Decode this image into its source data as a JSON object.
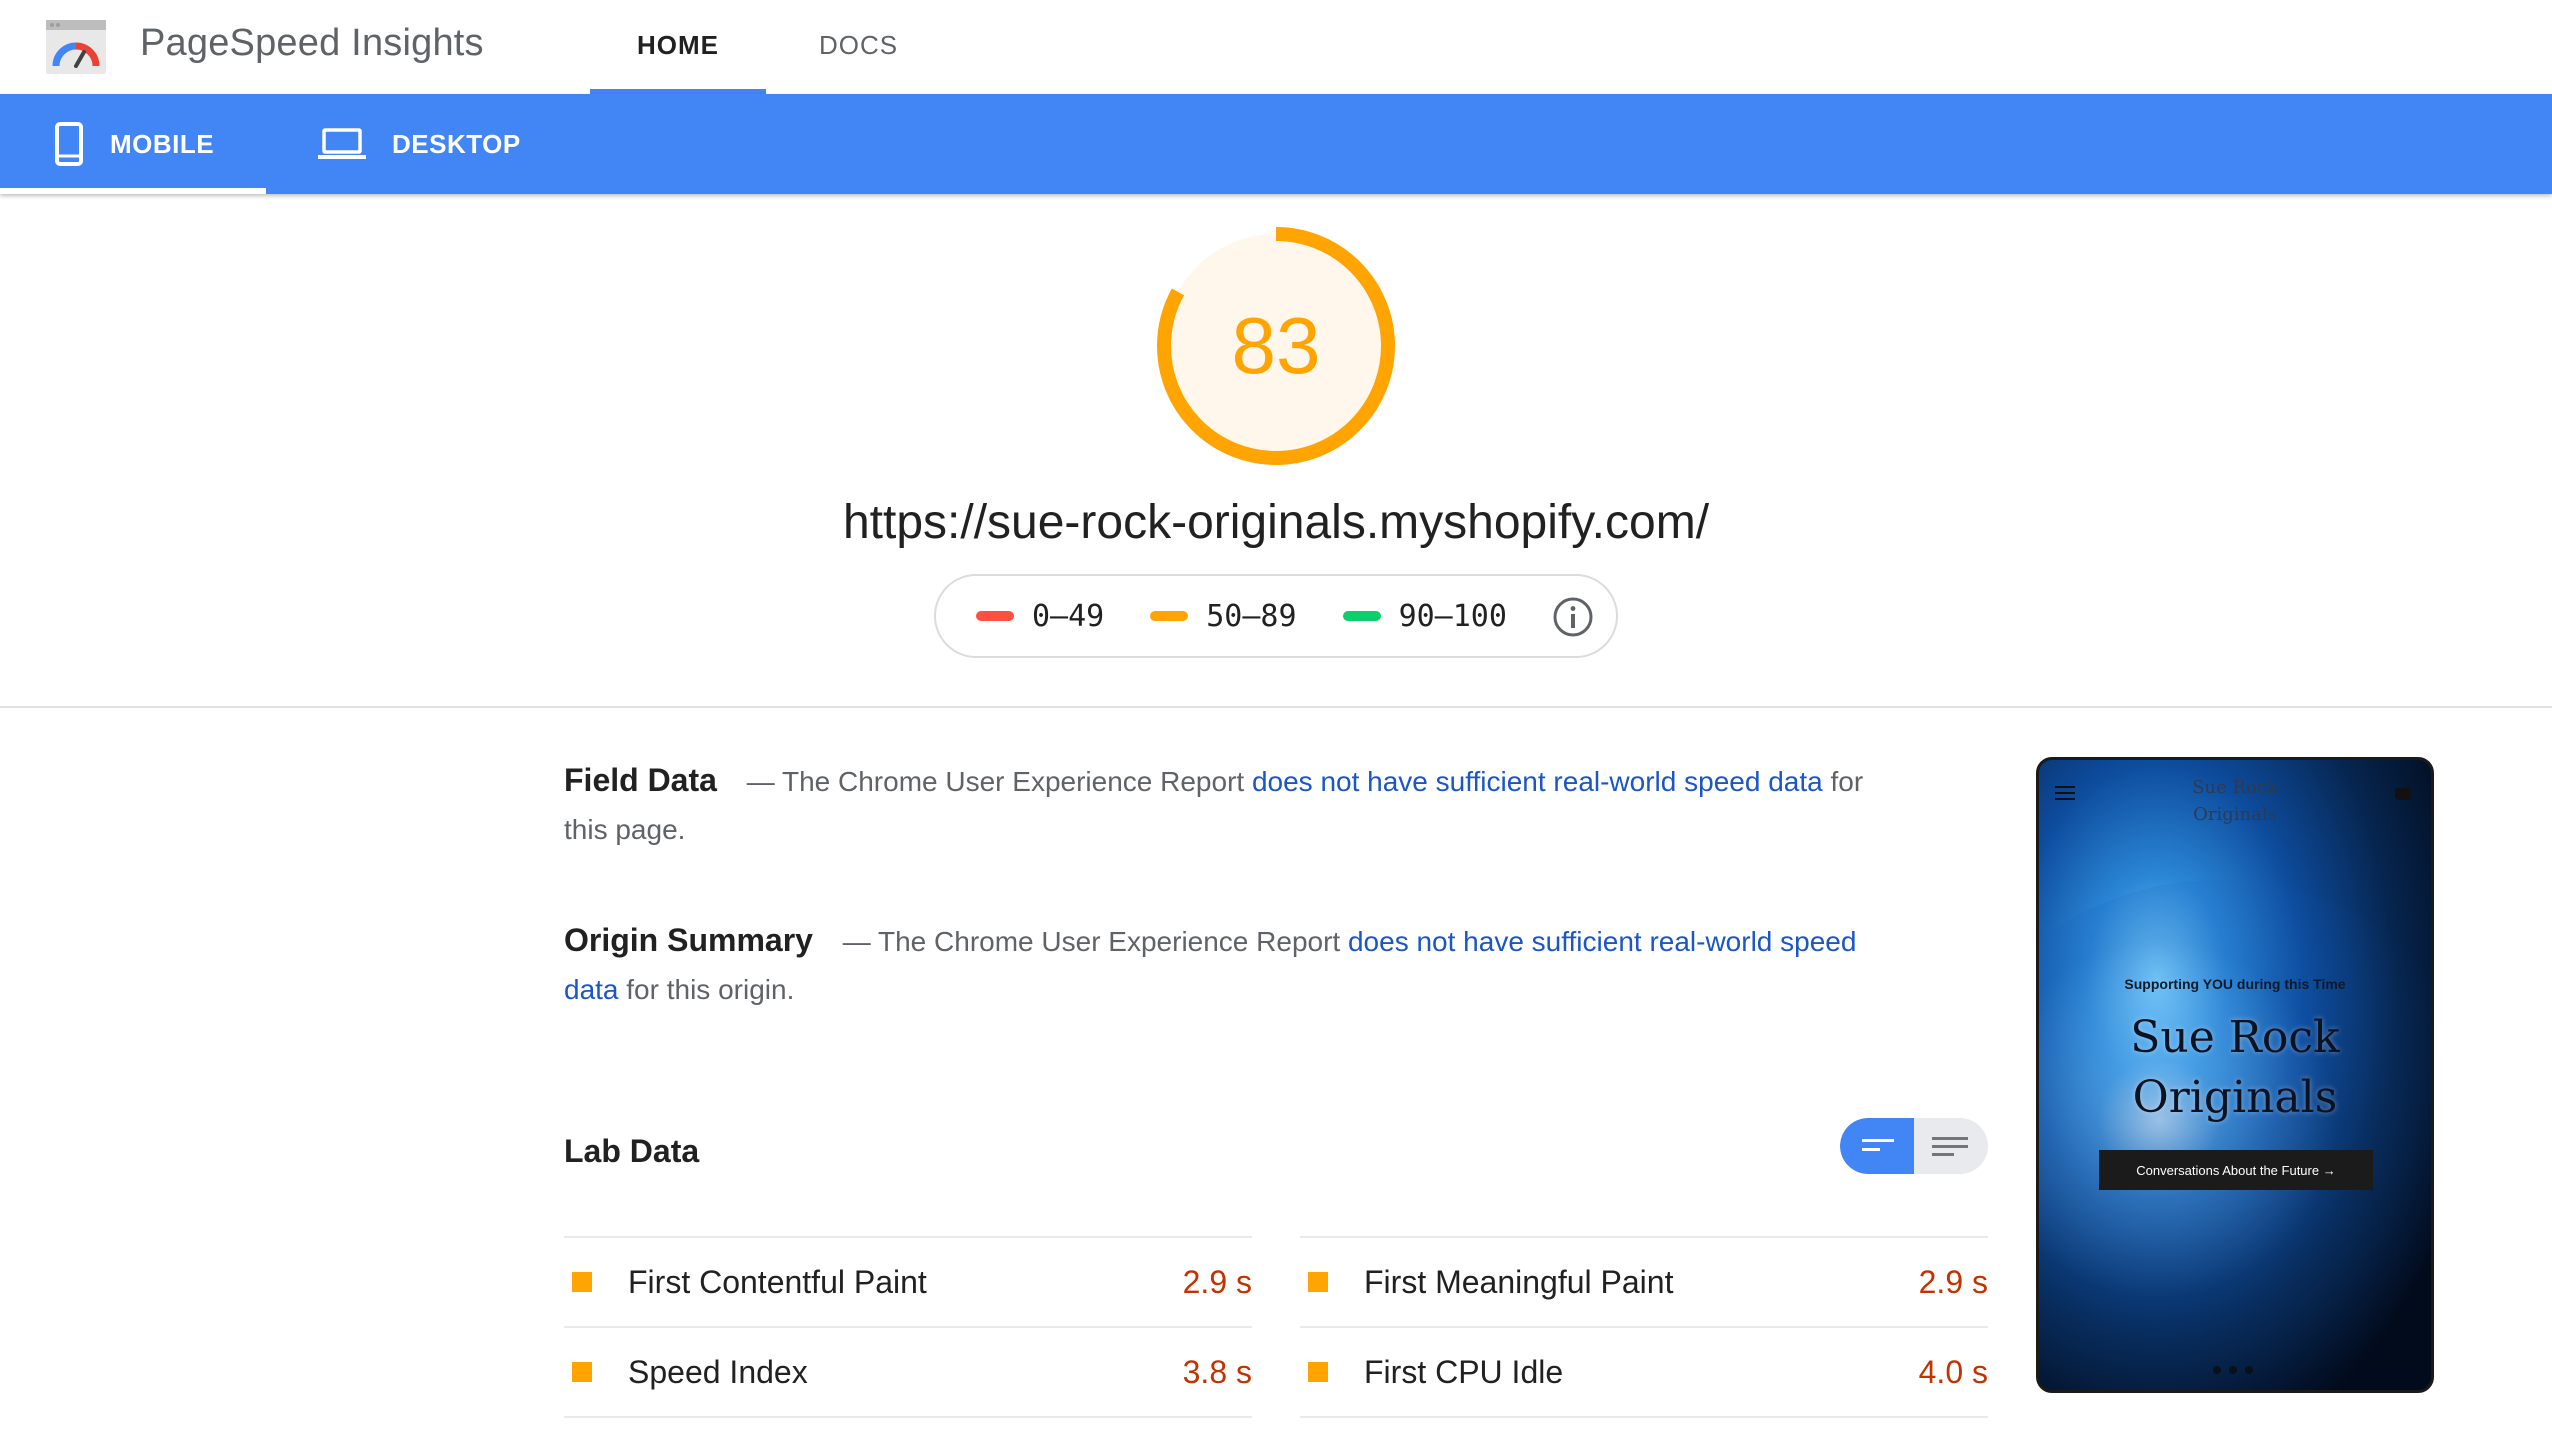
{
  "app": {
    "title": "PageSpeed Insights"
  },
  "nav": {
    "tabs": [
      {
        "label": "HOME"
      },
      {
        "label": "DOCS"
      }
    ]
  },
  "device": {
    "tabs": [
      {
        "label": "MOBILE"
      },
      {
        "label": "DESKTOP"
      }
    ]
  },
  "score": {
    "value": 83,
    "fraction": 0.83,
    "color": "#ffa400"
  },
  "url": "https://sue-rock-originals.myshopify.com/",
  "legend": [
    {
      "range": "0–49",
      "color": "#ff4e42"
    },
    {
      "range": "50–89",
      "color": "#ffa400"
    },
    {
      "range": "90–100",
      "color": "#0cce6b"
    }
  ],
  "field_data": {
    "title": "Field Data",
    "prefix": "— The Chrome User Experience Report",
    "link": "does not have sufficient real-world speed data",
    "suffix_1": "for",
    "suffix_2": "this page."
  },
  "origin_summary": {
    "title": "Origin Summary",
    "prefix": "— The Chrome User Experience Report",
    "link_1": "does not have sufficient real-world speed",
    "link_2": "data",
    "suffix": "for this origin."
  },
  "lab_data": {
    "title": "Lab Data",
    "metrics": [
      {
        "name": "First Contentful Paint",
        "value": "2.9 s"
      },
      {
        "name": "First Meaningful Paint",
        "value": "2.9 s"
      },
      {
        "name": "Speed Index",
        "value": "3.8 s"
      },
      {
        "name": "First CPU Idle",
        "value": "4.0 s"
      }
    ]
  },
  "screenshot": {
    "brand_small_1": "Sue Rock",
    "brand_small_2": "Originals",
    "tagline": "Supporting YOU during this Time",
    "brand_big_1": "Sue Rock",
    "brand_big_2": "Originals",
    "cta": "Conversations About the Future →"
  }
}
